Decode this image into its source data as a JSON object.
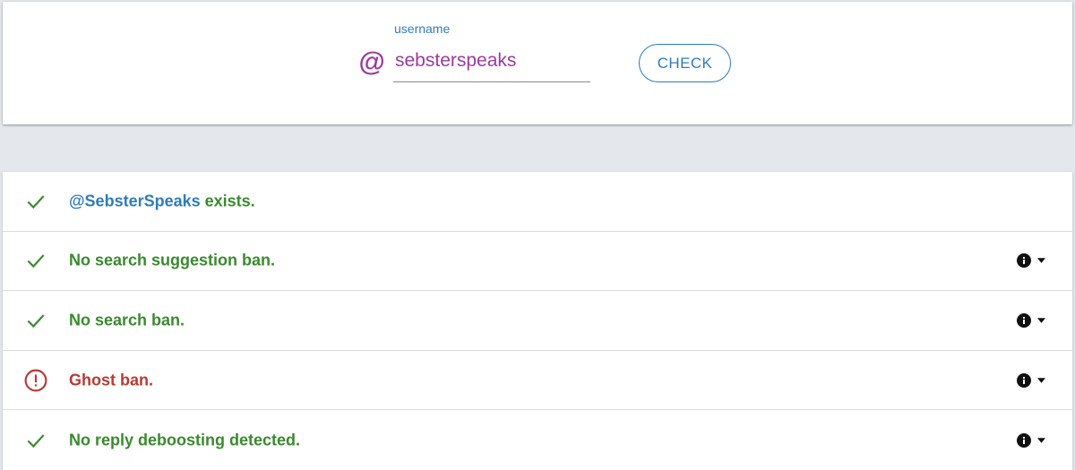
{
  "search": {
    "at_symbol": "@",
    "label": "username",
    "value": "sebsterspeaks",
    "button_label": "CHECK"
  },
  "results": [
    {
      "status": "ok",
      "handle": "@SebsterSpeaks",
      "text": " exists.",
      "has_info": false
    },
    {
      "status": "ok",
      "text": "No search suggestion ban.",
      "has_info": true
    },
    {
      "status": "ok",
      "text": "No search ban.",
      "has_info": true
    },
    {
      "status": "bad",
      "text": "Ghost ban.",
      "has_info": true
    },
    {
      "status": "ok",
      "text": "No reply deboosting detected.",
      "has_info": true
    }
  ],
  "colors": {
    "accent_blue": "#2f7bbd",
    "accent_purple": "#9c3a9e",
    "ok_green": "#3a8a2e",
    "bad_red": "#b83a34",
    "background": "#e4e8ec"
  },
  "icons": {
    "ok": "check-icon",
    "bad": "alert-circle-icon",
    "info": "info-icon",
    "toggle": "caret-down-icon"
  }
}
